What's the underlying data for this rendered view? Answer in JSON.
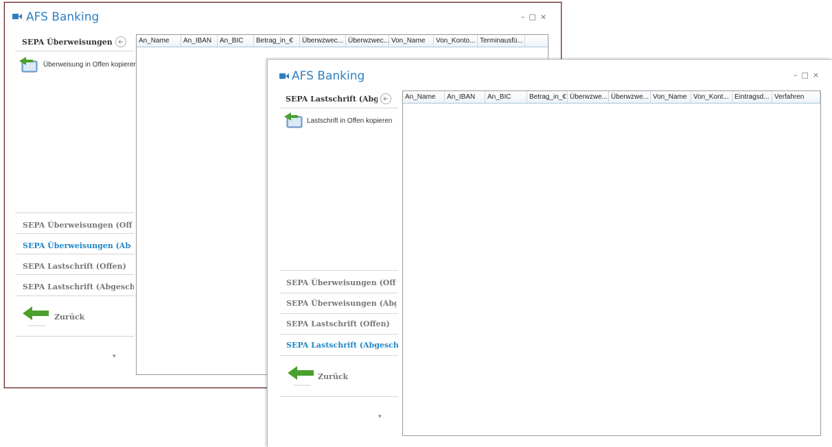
{
  "window1": {
    "app_title": "AFS Banking",
    "section_header": "SEPA Überweisungen (Abgeschlossen)",
    "action_label": "Überweisung in Offen kopieren",
    "nav": [
      {
        "label": "SEPA Überweisungen (Offen)",
        "active": false
      },
      {
        "label": "SEPA Überweisungen (Abgeschlossen)",
        "active": true
      },
      {
        "label": "SEPA Lastschrift (Offen)",
        "active": false
      },
      {
        "label": "SEPA Lastschrift (Abgeschlossen)",
        "active": false
      }
    ],
    "back_label": "Zurück",
    "columns": [
      "An_Name",
      "An_IBAN",
      "An_BIC",
      "Betrag_in_€",
      "Überwzwec...",
      "Überwzwec...",
      "Von_Name",
      "Von_Konto...",
      "Terminausfü..."
    ]
  },
  "window2": {
    "app_title": "AFS Banking",
    "section_header": "SEPA Lastschrift (Abgeschlossen)",
    "action_label": "Lastschrift in Offen kopieren",
    "nav": [
      {
        "label": "SEPA Überweisungen (Offen)",
        "active": false
      },
      {
        "label": "SEPA Überweisungen (Abgeschlossen)",
        "active": false
      },
      {
        "label": "SEPA Lastschrift (Offen)",
        "active": false
      },
      {
        "label": "SEPA Lastschrift (Abgeschlossen)",
        "active": true
      }
    ],
    "back_label": "Zurück",
    "columns": [
      "An_Name",
      "An_IBAN",
      "An_BIC",
      "Betrag_in_€",
      "Überwzwe...",
      "Überwzwe...",
      "Von_Name",
      "Von_Kont...",
      "Eintragsd...",
      "Verfahren"
    ]
  },
  "window_controls": {
    "minimize": "–",
    "maximize": "□",
    "close": "×"
  },
  "colors": {
    "accent": "#1f86c7",
    "title": "#2f7fc0",
    "arrow_green": "#4aa02c"
  }
}
